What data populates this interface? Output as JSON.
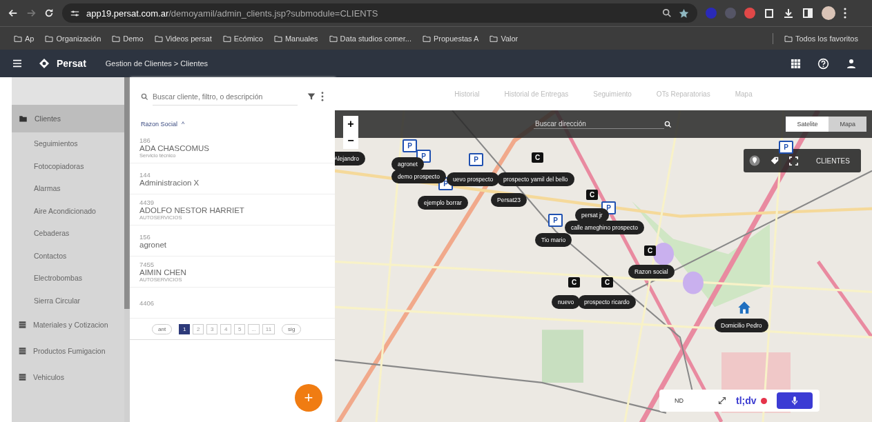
{
  "browser": {
    "url_host": "app19.persat.com.ar",
    "url_path": "/demoyamil/admin_clients.jsp?submodule=CLIENTS",
    "bookmarks": [
      "Ap",
      "Organización",
      "Demo",
      "Videos persat",
      "Ecómico",
      "Manuales",
      "Data studios comer...",
      "Propuestas A",
      "Valor"
    ],
    "all_bookmarks": "Todos los favoritos"
  },
  "app": {
    "logo": "Persat",
    "breadcrumb": "Gestion de Clientes > Clientes"
  },
  "sidebar": {
    "items": [
      {
        "kind": "group",
        "label": "Clientes",
        "selected": true
      },
      {
        "kind": "sub",
        "label": "Seguimientos",
        "selected": false
      },
      {
        "kind": "sub",
        "label": "Fotocopiadoras",
        "selected": false
      },
      {
        "kind": "sub",
        "label": "Alarmas",
        "selected": false
      },
      {
        "kind": "sub",
        "label": "Aire Acondicionado",
        "selected": false
      },
      {
        "kind": "sub",
        "label": "Cebaderas",
        "selected": false
      },
      {
        "kind": "sub",
        "label": "Contactos",
        "selected": false
      },
      {
        "kind": "sub",
        "label": "Electrobombas",
        "selected": false
      },
      {
        "kind": "sub",
        "label": "Sierra Circular",
        "selected": false
      },
      {
        "kind": "group",
        "label": "Materiales y Cotizacion",
        "selected": false
      },
      {
        "kind": "group",
        "label": "Productos Fumigacion",
        "selected": false
      },
      {
        "kind": "group",
        "label": "Vehiculos",
        "selected": false
      }
    ]
  },
  "list": {
    "search": {
      "placeholder": "Buscar cliente, filtro, o descripción"
    },
    "sort_header": "Razon Social",
    "sort_arrow": "^",
    "rows": [
      {
        "code": "186",
        "name": "ADA CHASCOMUS",
        "category": "Servicio técnico"
      },
      {
        "code": "144",
        "name": "Administracion X"
      },
      {
        "code": "4439",
        "name": "ADOLFO NESTOR HARRIET",
        "category": "AUTOSERVICIOS"
      },
      {
        "code": "156",
        "name": "agronet"
      },
      {
        "code": "7455",
        "name": "AIMIN CHEN",
        "category": "AUTOSERVICIOS"
      },
      {
        "code": "4406"
      }
    ],
    "pagination": {
      "prev": "ant",
      "next": "sig",
      "pages": [
        {
          "label": "1",
          "selected": true
        },
        {
          "label": "2",
          "selected": false
        },
        {
          "label": "3",
          "selected": false
        },
        {
          "label": "4",
          "selected": false
        },
        {
          "label": "5",
          "selected": false
        },
        {
          "label": "...",
          "selected": false
        },
        {
          "label": "11",
          "selected": false
        }
      ]
    },
    "add_button": "+"
  },
  "tabs": [
    "Historial",
    "Historial de Entregas",
    "Seguimiento",
    "OTs Reparatorias",
    "Mapa"
  ],
  "map": {
    "zoom_in": "+",
    "zoom_out": "−",
    "address_search": {
      "placeholder": "Buscar dirección"
    },
    "view_toggle": [
      {
        "label": "Satelite",
        "selected": true
      },
      {
        "label": "Mapa",
        "selected": false
      }
    ],
    "layer_label": "CLIENTES",
    "pins": [
      {
        "kind": "letter",
        "letter": "P"
      },
      {
        "kind": "letter",
        "letter": "P"
      },
      {
        "kind": "letter",
        "letter": "P"
      },
      {
        "kind": "letter",
        "letter": "C"
      },
      {
        "kind": "letter",
        "letter": "P"
      },
      {
        "kind": "letter",
        "letter": "C"
      },
      {
        "kind": "letter",
        "letter": "P"
      },
      {
        "kind": "letter",
        "letter": "P"
      },
      {
        "kind": "letter",
        "letter": "C"
      },
      {
        "kind": "letter",
        "letter": "C"
      },
      {
        "kind": "letter",
        "letter": "C"
      },
      {
        "kind": "home"
      },
      {
        "kind": "letter",
        "letter": "P"
      }
    ],
    "labels": [
      "Alejandro",
      "agronet",
      "demo prospecto",
      "uevo prospecto",
      "prospecto yamil del bello",
      "ejemplo borrar",
      "Persat23",
      "persat jr",
      "calle ameghino prospecto",
      "Tio mario",
      "Razon social",
      "nuevo",
      "prospecto ricardo",
      "Domicilio Pedro"
    ]
  },
  "recorder": {
    "text": "ND",
    "logo": "tl;dv"
  }
}
